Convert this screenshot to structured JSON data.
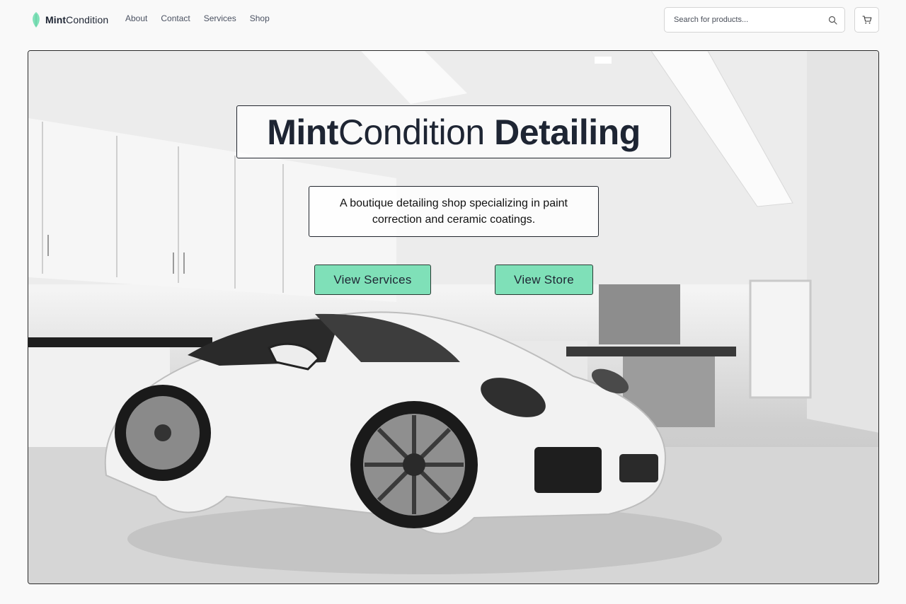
{
  "brand": {
    "name_bold": "Mint",
    "name_regular": "Condition",
    "icon": "leaf-icon",
    "color": "#7fe0b8"
  },
  "nav": {
    "items": [
      "About",
      "Contact",
      "Services",
      "Shop"
    ]
  },
  "search": {
    "placeholder": "Search for products...",
    "value": "",
    "icon": "search-icon"
  },
  "cart": {
    "icon": "cart-icon"
  },
  "hero": {
    "title_bold_1": "Mint",
    "title_regular": "Condition",
    "title_bold_2": "Detailing",
    "subtitle": "A boutique detailing shop specializing in paint correction and ceramic coatings.",
    "primary_cta": "View Services",
    "secondary_cta": "View Store",
    "button_color": "#7fe0b8"
  }
}
